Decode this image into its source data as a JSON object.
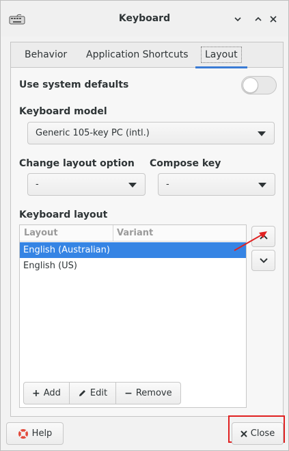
{
  "window": {
    "title": "Keyboard",
    "icons": [
      "keyboard-icon",
      "minimize-icon",
      "maximize-icon",
      "close-icon"
    ]
  },
  "tabs": [
    {
      "label": "Behavior",
      "active": false
    },
    {
      "label": "Application Shortcuts",
      "active": false
    },
    {
      "label": "Layout",
      "active": true
    }
  ],
  "use_system_defaults": {
    "label": "Use system defaults",
    "enabled": false
  },
  "keyboard_model": {
    "label": "Keyboard model",
    "value": "Generic 105-key PC (intl.)"
  },
  "change_layout_option": {
    "label": "Change layout option",
    "value": "-"
  },
  "compose_key": {
    "label": "Compose key",
    "value": "-"
  },
  "keyboard_layout": {
    "label": "Keyboard layout",
    "columns": [
      "Layout",
      "Variant"
    ],
    "rows": [
      {
        "layout": "English (Australian)",
        "variant": "",
        "selected": true
      },
      {
        "layout": "English (US)",
        "variant": "",
        "selected": false
      }
    ],
    "toolbar": {
      "add": "Add",
      "edit": "Edit",
      "remove": "Remove"
    }
  },
  "footer": {
    "help": "Help",
    "close": "Close"
  },
  "colors": {
    "accent": "#3584e4",
    "annotation": "#e02020"
  }
}
